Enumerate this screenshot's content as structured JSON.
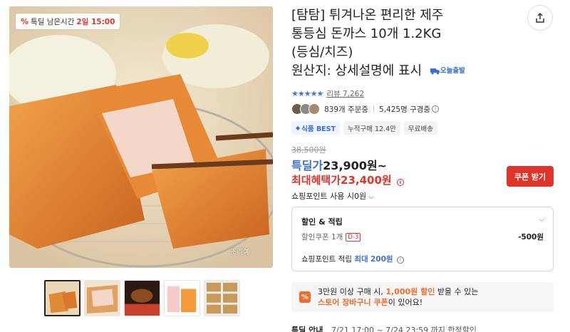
{
  "product": {
    "title_line1": "[탐탐] 튀겨나온 편리한 제주",
    "title_line2": "통등심 돈까스 10개 1.2KG",
    "title_line3": "(등심/치즈)",
    "title_line4": "원산지: 상세설명에 표시",
    "delivery_tag": "오늘출발"
  },
  "deal_badge": {
    "icon": "%",
    "label": "특딜 남은시간",
    "time": "2일 15:00"
  },
  "image_note": "조리예",
  "rating": {
    "stars": "★★★★★",
    "review_label": "리뷰",
    "review_count": "7,262"
  },
  "stats": {
    "orders": "839개 주문중",
    "purchases": "5,425명 구경중"
  },
  "chips": [
    "식품 BEST",
    "누적구매 12.4만",
    "무료배송"
  ],
  "pricing": {
    "original": "38,500원",
    "deal_label": "특딜가",
    "deal_price": "23,900원~",
    "max_label": "최대혜택가",
    "max_price": "23,400원",
    "coupon_button": "쿠폰 받기",
    "points_use": "쇼핑포인트 사용 시0원"
  },
  "discount": {
    "heading": "할인 & 적립",
    "coupon_label": "할인쿠폰 1개",
    "coupon_dday": "D-3",
    "coupon_value": "-500원",
    "points_label": "쇼핑포인트 적립",
    "points_prefix": "최대",
    "points_value": "200원"
  },
  "promo": {
    "icon": "%",
    "line1_a": "3만원 이상 구매 시,",
    "line1_b": "1,000원 할인",
    "line1_c": "받을 수 있는",
    "line2_a": "스토어 장바구니 쿠폰",
    "line2_b": "이 있어요!"
  },
  "bottom": {
    "label": "특딜 안내",
    "text": "7/21 17:00 ~ 7/24 23:59 까지 한정할인"
  },
  "colors": {
    "accent_red": "#e0342b",
    "accent_blue": "#3d6fd6",
    "accent_orange": "#f36b2a"
  }
}
